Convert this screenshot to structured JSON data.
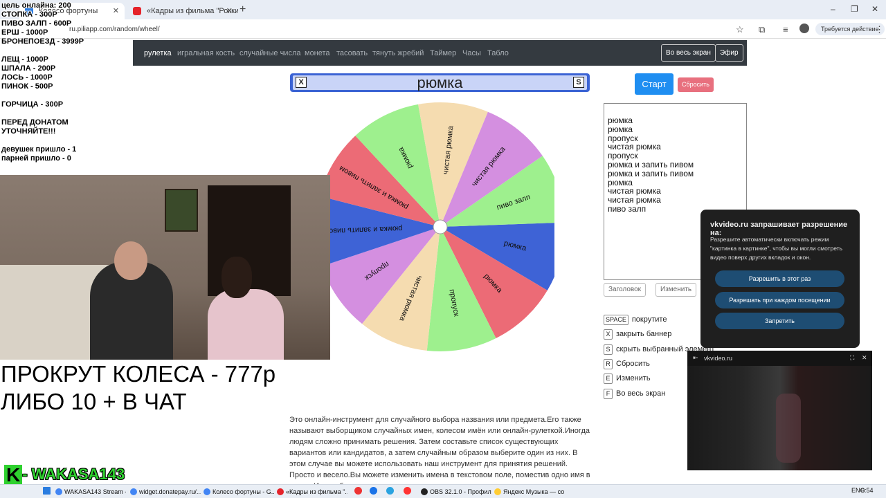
{
  "browser": {
    "tabs": [
      {
        "title": "Колесо фортуны",
        "active": true
      },
      {
        "title": "«Кадры из фильма \"Рокки\"",
        "active": false
      }
    ],
    "new_tab": "+",
    "url": "ru.piliapp.com/random/wheel/",
    "permission_chip": "Требуется действие",
    "window_controls": {
      "minimize": "–",
      "maximize": "❐",
      "close": "✕"
    }
  },
  "site_nav": {
    "links": [
      "рулетка",
      "игральная кость",
      "случайные числа",
      "монета",
      "тасовать",
      "тянуть жребий",
      "Таймер",
      "Часы",
      "Табло"
    ],
    "fullscreen_label": "Во весь экран",
    "broadcast_label": "Эфир"
  },
  "banner": {
    "text": "рюмка",
    "close_key": "X",
    "save_key": "S"
  },
  "controls": {
    "start": "Старт",
    "reset": "Сбросить",
    "title_btn": "Заголовок",
    "edit_btn": "Изменить"
  },
  "name_list": [
    "рюмка",
    "рюмка",
    "пропуск",
    "чистая рюмка",
    "пропуск",
    "рюмка и запить пивом",
    "рюмка и запить пивом",
    "рюмка",
    "чистая рюмка",
    "чистая рюмка",
    "пиво залп"
  ],
  "wheel": {
    "segments": [
      {
        "label": "рюмка",
        "color": "#3e63d6"
      },
      {
        "label": "рюмка",
        "color": "#ec6b76"
      },
      {
        "label": "пропуск",
        "color": "#9ef08e"
      },
      {
        "label": "чистая рюмка",
        "color": "#f5dcb0"
      },
      {
        "label": "пропуск",
        "color": "#d48fe0"
      },
      {
        "label": "рюмка и запить пивом",
        "color": "#3e63d6"
      },
      {
        "label": "рюмка и запить пивом",
        "color": "#ec6b76"
      },
      {
        "label": "рюмка",
        "color": "#9ef08e"
      },
      {
        "label": "чистая рюмка",
        "color": "#f5dcb0"
      },
      {
        "label": "чистая рюмка",
        "color": "#d48fe0"
      },
      {
        "label": "пиво залп",
        "color": "#9ef08e"
      }
    ],
    "pointer_color": "#e01010"
  },
  "shortcuts": [
    {
      "key": "SPACE",
      "label": "покрутите"
    },
    {
      "key": "X",
      "label": "закрыть баннер"
    },
    {
      "key": "S",
      "label": "скрыть выбранный элемент"
    },
    {
      "key": "R",
      "label": "Сбросить"
    },
    {
      "key": "E",
      "label": "Изменить"
    },
    {
      "key": "F",
      "label": "Во весь экран"
    }
  ],
  "description": "Это онлайн-инструмент для случайного выбора названия или предмета.Его также называют выборщиком случайных имен, колесом имён или онлайн-рулеткой.Иногда людям сложно принимать решения. Затем составьте список существующих вариантов или кандидатов, а затем случайным образом выберите один из них. В этом случае вы можете использовать наш инструмент для принятия решений. Просто и весело.Вы можете изменить имена в текстовом поле, поместив одно имя в строку.Имена будут",
  "stream_overlay": {
    "lines": [
      "цель онлайна: 200",
      "СТОПКА - 300Р",
      "ПИВО ЗАЛП - 600Р",
      "ЕРШ - 1000Р",
      "БРОНЕПОЕЗД - 3999Р",
      "",
      "ЛЕЩ - 1000Р",
      "ШПАЛА - 200Р",
      "ЛОСЬ - 1000Р",
      "ПИНОК - 500Р",
      "",
      "ГОРЧИЦА - 300Р",
      "",
      "ПЕРЕД  ДОНАТОМ",
      "УТОЧНЯЙТЕ!!!",
      "",
      "девушек пришло - 1",
      "парней пришло - 0"
    ],
    "promo_line1": "ПРОКРУТ КОЛЕСА - 777р",
    "promo_line2": "ЛИБО 10 + В ЧАТ",
    "logo_k": "K",
    "logo_text": "- WAKASA143"
  },
  "permission_popup": {
    "title": "vkvideo.ru запрашивает разрешение на:",
    "body": "Разрешите автоматически включать режим \"картинка в картинке\", чтобы вы могли смотреть видео поверх других вкладок и окон.",
    "allow_once": "Разрешить в этот раз",
    "allow_always": "Разрешать при каждом посещении",
    "deny": "Запретить"
  },
  "pip": {
    "title": "vkvideo.ru"
  },
  "taskbar": {
    "items": [
      "WAKASA143 Stream -...",
      "widget.donatepay.ru/...",
      "Колесо фортуны - G...",
      "«Кадры из фильма \"...",
      "OBS 32.1.0 - Профил...",
      "Яндекс Музыка — со..."
    ],
    "lang": "ENG",
    "time": "0:54"
  }
}
